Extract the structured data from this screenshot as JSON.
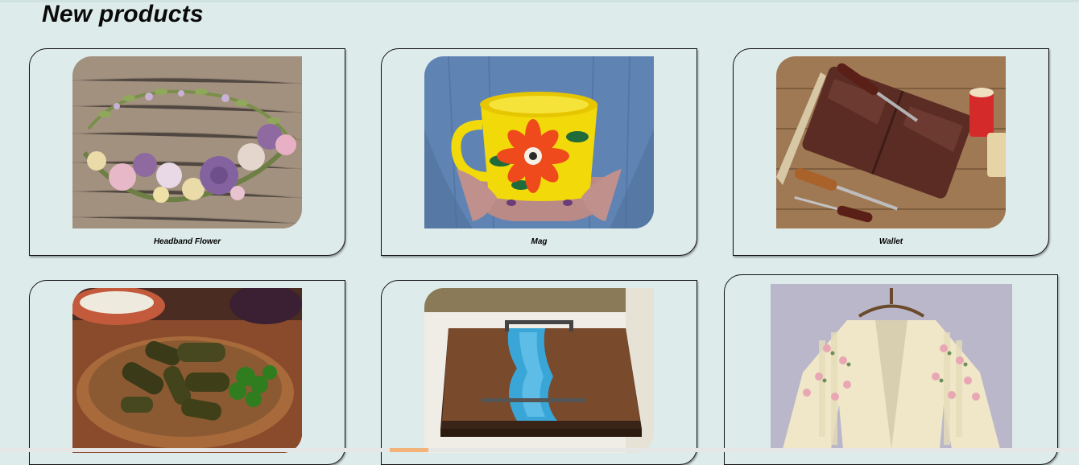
{
  "section": {
    "title": "New products"
  },
  "products": [
    {
      "name": "Headband Flower",
      "image": "flower-headband-image"
    },
    {
      "name": "Mag",
      "image": "painted-mug-image"
    },
    {
      "name": "Wallet",
      "image": "leather-wallet-image"
    },
    {
      "name": "",
      "image": "stuffed-grape-leaves-image"
    },
    {
      "name": "",
      "image": "resin-serving-tray-image"
    },
    {
      "name": "",
      "image": "knit-cardigan-image"
    }
  ],
  "colors": {
    "background": "#ddecea",
    "card_border": "#111111",
    "text": "#000000",
    "scroll_thumb": "#f2b27a"
  }
}
